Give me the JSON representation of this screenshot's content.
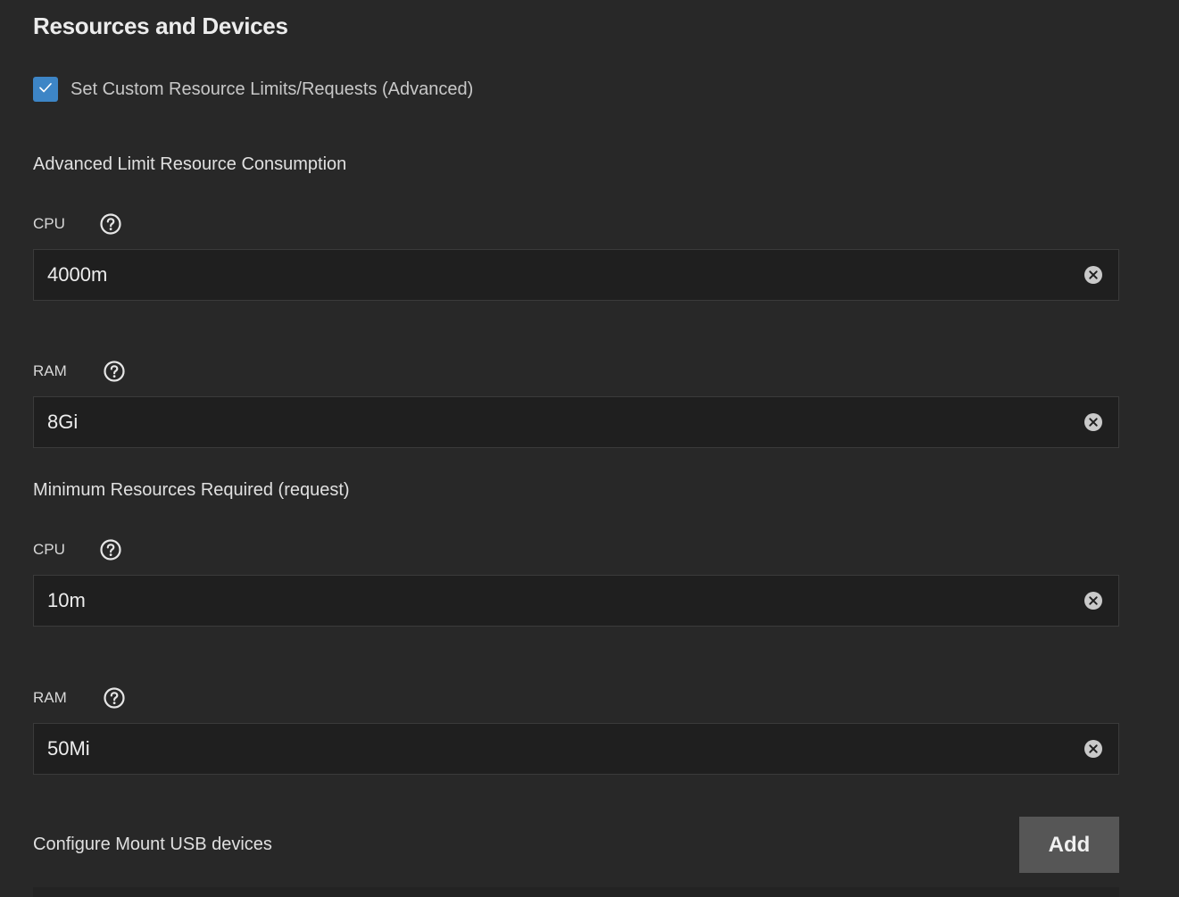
{
  "section": {
    "title": "Resources and Devices"
  },
  "custom_limits": {
    "label": "Set Custom Resource Limits/Requests (Advanced)",
    "checked": true
  },
  "limits": {
    "heading": "Advanced Limit Resource Consumption",
    "cpu": {
      "label": "CPU",
      "value": "4000m"
    },
    "ram": {
      "label": "RAM",
      "value": "8Gi"
    }
  },
  "requests": {
    "heading": "Minimum Resources Required (request)",
    "cpu": {
      "label": "CPU",
      "value": "10m"
    },
    "ram": {
      "label": "RAM",
      "value": "50Mi"
    }
  },
  "usb": {
    "label": "Configure Mount USB devices",
    "add_label": "Add"
  },
  "icons": {
    "checkbox": "check-icon",
    "help": "help-circle-icon",
    "clear": "clear-circle-icon"
  },
  "colors": {
    "background": "#282828",
    "input_background": "#1f1f1f",
    "accent": "#3d85c6",
    "button": "#565656"
  }
}
